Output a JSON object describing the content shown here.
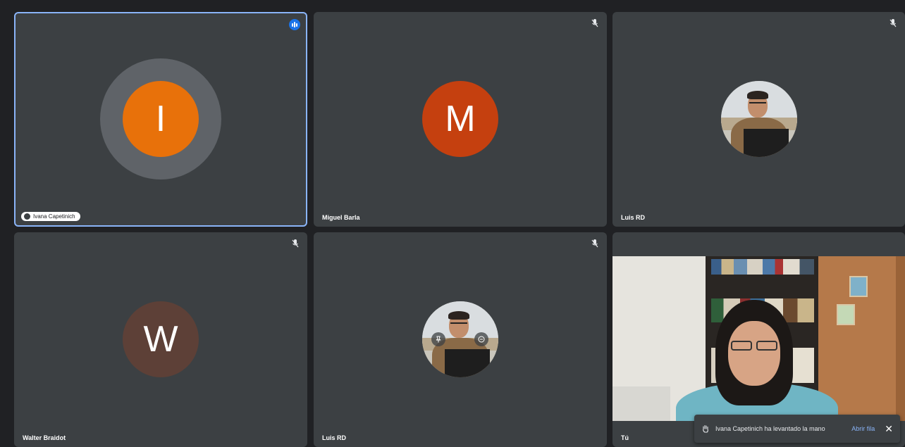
{
  "participants": [
    {
      "name": "Ivana Capetinich",
      "initial": "I",
      "avatar_color": "#e8710a",
      "state": "speaking",
      "hand_raised": true
    },
    {
      "name": "Miguel Barla",
      "initial": "M",
      "avatar_color": "#c5400f",
      "state": "muted"
    },
    {
      "name": "Luis RD",
      "initial": "",
      "avatar_type": "photo",
      "state": "muted"
    },
    {
      "name": "Walter Braidot",
      "initial": "W",
      "avatar_color": "#5d4037",
      "state": "muted"
    },
    {
      "name": "Luis RD",
      "initial": "",
      "avatar_type": "photo",
      "state": "muted",
      "hover_controls": [
        "pin-icon",
        "more-options-icon"
      ]
    },
    {
      "name": "Tú",
      "avatar_type": "video",
      "state": "self"
    }
  ],
  "toast": {
    "message": "Ivana Capetinich ha levantado la mano",
    "action": "Abrir fila",
    "close": "✕",
    "icon": "raised-hand-icon"
  },
  "colors": {
    "background": "#202124",
    "tile": "#3c4043",
    "speaking_border": "#8ab4f8",
    "accent": "#8ab4f8",
    "speak_badge": "#1a73e8"
  }
}
